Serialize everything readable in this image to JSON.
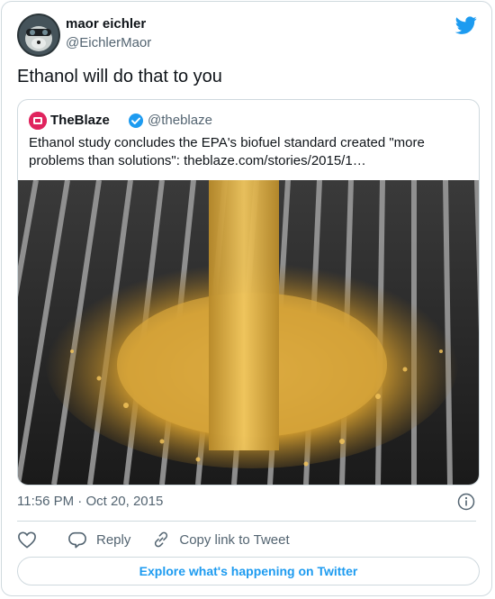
{
  "author": {
    "display_name": "maor eichler",
    "handle": "@EichlerMaor",
    "avatar_icon": "avatar-icon"
  },
  "tweet": {
    "text": "Ethanol will do that to you",
    "time": "11:56 PM",
    "separator": "·",
    "date": "Oct 20, 2015"
  },
  "quoted": {
    "display_name": "TheBlaze",
    "handle": "@theblaze",
    "text": "Ethanol study concludes the EPA's biofuel standard created \"more problems than solutions\": theblaze.com/stories/2015/1…",
    "verified_icon": "verified-badge-icon",
    "image_icon": "corn-grain-photo"
  },
  "actions": {
    "like_icon": "heart-icon",
    "reply_label": "Reply",
    "copy_link_label": "Copy link to Tweet"
  },
  "footer": {
    "explore_label": "Explore what's happening on Twitter"
  },
  "colors": {
    "twitter_blue": "#1d9bf0",
    "border": "#cfd9de",
    "secondary_text": "#536471",
    "blaze_red": "#e0245e"
  }
}
